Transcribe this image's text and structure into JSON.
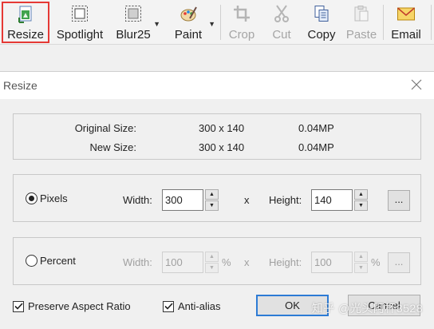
{
  "toolbar": {
    "items": [
      {
        "label": "Resize",
        "icon": "resize-icon",
        "selected": true,
        "disabled": false
      },
      {
        "label": "Spotlight",
        "icon": "spotlight-icon",
        "disabled": false
      },
      {
        "label": "Blur25",
        "icon": "blur-icon",
        "disabled": false,
        "dropdown": true
      },
      {
        "label": "Paint",
        "icon": "paint-icon",
        "disabled": false,
        "dropdown": true
      },
      {
        "label": "Crop",
        "icon": "crop-icon",
        "disabled": true
      },
      {
        "label": "Cut",
        "icon": "scissors-icon",
        "disabled": true
      },
      {
        "label": "Copy",
        "icon": "copy-icon",
        "disabled": false
      },
      {
        "label": "Paste",
        "icon": "paste-icon",
        "disabled": true
      },
      {
        "label": "Email",
        "icon": "email-icon",
        "disabled": false
      }
    ],
    "selected_color": "#e53935"
  },
  "dialog": {
    "title": "Resize",
    "info": {
      "original_label": "Original Size:",
      "original_dims": "300 x 140",
      "original_mp": "0.04MP",
      "new_label": "New Size:",
      "new_dims": "300 x 140",
      "new_mp": "0.04MP"
    },
    "pixels": {
      "radio_label": "Pixels",
      "selected": true,
      "width_label": "Width:",
      "width_value": "300",
      "x_label": "x",
      "height_label": "Height:",
      "height_value": "140",
      "more_label": "..."
    },
    "percent": {
      "radio_label": "Percent",
      "selected": false,
      "width_label": "Width:",
      "width_value": "100",
      "unit": "%",
      "x_label": "x",
      "height_label": "Height:",
      "height_value": "100",
      "more_label": "..."
    },
    "preserve_aspect": {
      "label": "Preserve Aspect Ratio",
      "checked": true
    },
    "anti_alias": {
      "label": "Anti-alias",
      "checked": true
    },
    "ok_label": "OK",
    "cancel_label": "Cancel",
    "accent": "#2d7bd5"
  },
  "watermark": "知乎 @光头阿杯3528"
}
